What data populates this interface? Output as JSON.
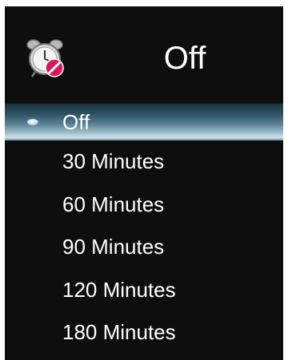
{
  "header": {
    "icon": "alarm-clock-off-icon",
    "title": "Off"
  },
  "menu": {
    "selected_index": 0,
    "items": [
      {
        "label": "Off"
      },
      {
        "label": "30 Minutes"
      },
      {
        "label": "60 Minutes"
      },
      {
        "label": "90 Minutes"
      },
      {
        "label": "120 Minutes"
      },
      {
        "label": "180 Minutes"
      }
    ]
  }
}
